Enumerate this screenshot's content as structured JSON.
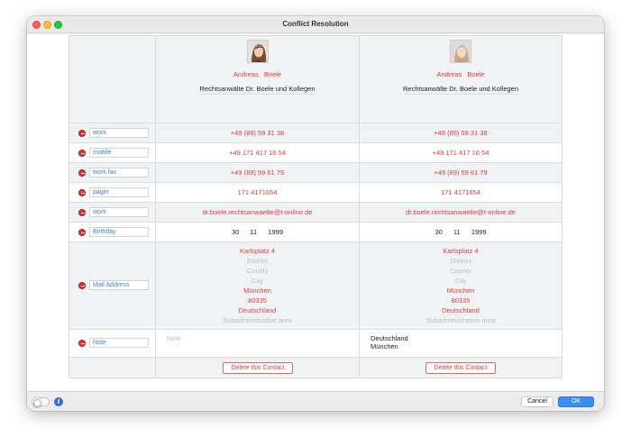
{
  "window": {
    "title": "Conflict Resolution"
  },
  "contacts": [
    {
      "first_name": "Andreas",
      "last_name": "Boele",
      "company": "Rechtsanwälte Dr. Boele und Kollegen",
      "phone_work": "+49 (89) 59 31 38",
      "phone_mobile": "+49 171  417 16 54",
      "fax_work": "+49 (89) 59 61 79",
      "pager": "171 4171654",
      "email_work": "dr.boele.rechtsanwaelte@t-online.de",
      "birthday": {
        "day": "30",
        "month": "11",
        "year": "1999"
      },
      "address": {
        "street": "Karlsplatz 4",
        "district": "District",
        "county": "County",
        "city_ph": "City",
        "city": "München",
        "zip": "80335",
        "country": "Deutschland",
        "subadmin": "Subadministrative area"
      },
      "note_placeholder": "Note",
      "delete_label": "Delete this Contact"
    },
    {
      "first_name": "Andreas",
      "last_name": "Boele",
      "company": "Rechtsanwälte Dr. Boele und Kollegen",
      "phone_work": "+49 (89) 59 31 38",
      "phone_mobile": "+49 171  417 16 54",
      "fax_work": "+49 (89) 59 61 79",
      "pager": "171 4171654",
      "email_work": "dr.boele.rechtsanwaelte@t-online.de",
      "birthday": {
        "day": "30",
        "month": "11",
        "year": "1999"
      },
      "address": {
        "street": "Karlsplatz 4",
        "district": "District",
        "county": "County",
        "city_ph": "City",
        "city": "München",
        "zip": "80335",
        "country": "Deutschland",
        "subadmin": "Subadministrative area"
      },
      "note_lines": [
        "Deutschland",
        "München"
      ],
      "delete_label": "Delete this Contact"
    }
  ],
  "field_labels": {
    "work": "work",
    "mobile": "mobile",
    "work_fax": "work fax",
    "pager": "pager",
    "email_work": "work",
    "birthday": "Birthday",
    "mail_address": "Mail Address",
    "note": "Note"
  },
  "footer": {
    "cancel_label": "Cancel",
    "ok_label": "OK",
    "info_glyph": "i"
  },
  "icons": {
    "remove": "minus-circle-icon",
    "info": "info-icon"
  },
  "colors": {
    "changed_value": "#e53935",
    "label_text": "#3b7fd6",
    "ok_button": "#3a8ff0"
  }
}
